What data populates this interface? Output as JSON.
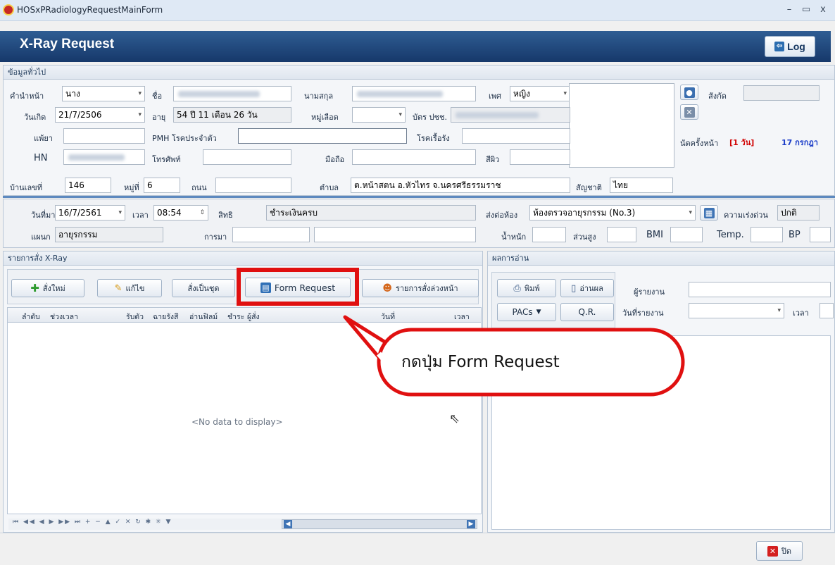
{
  "window": {
    "title": "HOSxPRadiologyRequestMainForm",
    "controls": [
      "–",
      "▭",
      "x"
    ]
  },
  "header": {
    "title": "X-Ray Request",
    "log_label": "Log"
  },
  "general": {
    "section_label": "ข้อมูลทั่วไป",
    "prefix_label": "คำนำหน้า",
    "prefix_value": "นาง",
    "fname_label": "ชื่อ",
    "lname_label": "นามสกุล",
    "sex_label": "เพศ",
    "sex_value": "หญิง",
    "birth_label": "วันเกิด",
    "birth_value": "21/7/2506",
    "age_label": "อายุ",
    "age_value": "54 ปี 11 เดือน 26 วัน",
    "blood_label": "หมู่เลือด",
    "cid_label": "บัตร ปชช.",
    "allergy_label": "แพ้ยา",
    "pmh_label": "PMH โรคประจำตัว",
    "chronic_label": "โรคเรื้อรัง",
    "hn_label": "HN",
    "phone_label": "โทรศัพท์",
    "mobile_label": "มือถือ",
    "skin_label": "สีผิว",
    "house_label": "บ้านเลขที่",
    "house_value": "146",
    "moo_label": "หมู่ที่",
    "moo_value": "6",
    "road_label": "ถนน",
    "tambon_label": "ตำบล",
    "tambon_value": "ต.หน้าสตน อ.หัวไทร จ.นครศรีธรรมราช",
    "nation_label": "สัญชาติ",
    "nation_value": "ไทย",
    "affiliation_label": "สังกัด",
    "next_appt_label": "นัดครั้งหน้า",
    "next_appt_days": "[1 วัน]",
    "next_appt_date": "17 กรกฎา"
  },
  "visit": {
    "date_label": "วันที่มา",
    "date_value": "16/7/2561",
    "time_label": "เวลา",
    "time_value": "08:54",
    "right_label": "สิทธิ",
    "right_value": "ชำระเงินครบ",
    "sendto_label": "ส่งต่อห้อง",
    "sendto_value": "ห้องตรวจอายุรกรรม (No.3)",
    "urgency_label": "ความเร่งด่วน",
    "urgency_value": "ปกติ",
    "dept_label": "แผนก",
    "dept_value": "อายุรกรรม",
    "visit_reason_label": "การมา",
    "weight_label": "น้ำหนัก",
    "height_label": "ส่วนสูง",
    "bmi_label": "BMI",
    "temp_label": "Temp.",
    "bp_label": "BP"
  },
  "orders": {
    "section_label": "รายการสั่ง X-Ray",
    "new_label": "สั่งใหม่",
    "edit_label": "แก้ไข",
    "set_label": "สั่งเป็นชุด",
    "form_request_label": "Form Request",
    "advance_label": "รายการสั่งล่วงหน้า",
    "columns": [
      "ลำดับ",
      "ช่วงเวลา",
      "รับตัว",
      "ฉายรังสี",
      "อ่านฟิลม์",
      "ชำระ",
      "ผู้สั่ง",
      "วันที่",
      "เวลา"
    ],
    "empty_text": "<No data to display>",
    "nav_glyphs": "⏮ ◀◀ ◀ ▶ ▶▶ ⏭ + − ▲ ✓ ✕ ↻ ✱ ✳ ▼"
  },
  "results": {
    "section_label": "ผลการอ่าน",
    "print_label": "พิมพ์",
    "read_label": "อ่านผล",
    "pacs_label": "PACs",
    "qr_label": "Q.R.",
    "reporter_label": "ผู้รายงาน",
    "report_date_label": "วันที่รายงาน",
    "time_label": "เวลา"
  },
  "callout": {
    "text": "กดปุ่ม Form Request"
  },
  "footer": {
    "close_label": "ปิด"
  },
  "colors": {
    "header": "#1f4a80",
    "highlight": "#e01010",
    "appt": "#d00000",
    "appt_date": "#1a3cc8"
  }
}
